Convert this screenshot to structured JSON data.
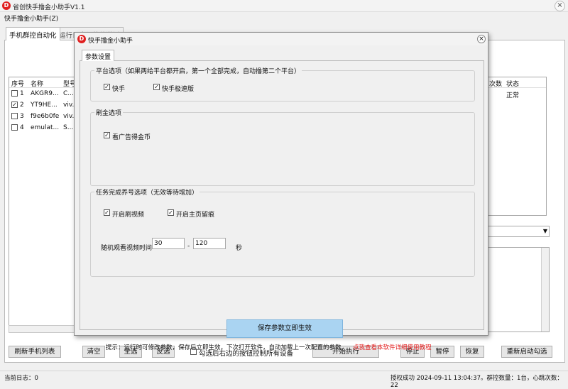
{
  "app": {
    "title": "省创快手撸金小助手V1.1",
    "menu_label": "快手撸金小助手(Z)",
    "close_glyph": "×",
    "icon_letter": "D"
  },
  "tabs": [
    {
      "label": "手机群控自动化"
    },
    {
      "label": "运行日志与软件激活"
    }
  ],
  "device_list": {
    "columns": [
      "序号",
      "名称",
      "型号"
    ],
    "rows": [
      {
        "index": "1",
        "name": "AKGR9...",
        "model": "C...",
        "checked": false
      },
      {
        "index": "2",
        "name": "YT9HE...",
        "model": "viv...",
        "checked": true
      },
      {
        "index": "3",
        "name": "f9e6b0fe",
        "model": "viv...",
        "checked": false
      },
      {
        "index": "4",
        "name": "emulat...",
        "model": "S...",
        "checked": false
      }
    ]
  },
  "right_list": {
    "columns": [
      "次数",
      "状态"
    ],
    "row_status": "正常"
  },
  "buttons": {
    "refresh": "刷新手机列表",
    "clear": "清空",
    "select_all": "全选",
    "invert": "反选",
    "start": "开始执行",
    "stop": "停止",
    "pause": "暂停",
    "resume": "恢复",
    "restart": "重新启动勾选"
  },
  "bottom_checkbox_label": "勾选后右边的按钮控制所有设备",
  "status_bar": {
    "log_count": "当前日志：0",
    "info": "授权成功 2024-09-11 13:04:37。群控数量：1台，心跳次数：22"
  },
  "dialog": {
    "title": "快手撸金小助手",
    "tab": "参数设置",
    "platform_group": {
      "title": "平台选项（如果两给平台都开启，第一个全部完成，自动撸第二个平台）",
      "options": [
        {
          "label": "快手",
          "checked": true
        },
        {
          "label": "快手极速版",
          "checked": true
        }
      ]
    },
    "gold_group": {
      "title": "刷金选项",
      "options": [
        {
          "label": "看广告得金币",
          "checked": true
        }
      ]
    },
    "task_group": {
      "title": "任务完成养号选项（无效等待增加）",
      "options": [
        {
          "label": "开启刷视频",
          "checked": true
        },
        {
          "label": "开启主页留痕",
          "checked": true
        }
      ],
      "random_label": "随机观看视频时间",
      "min_value": "30",
      "dash": "-",
      "max_value": "120",
      "unit": "秒"
    },
    "save_button": "保存参数立即生效",
    "hint": "提示：运行时可修改参数，保存后立即生效，下次打开软件，自动加载上一次配置的参数。",
    "help_link": "点我查看本软件详细使用教程"
  },
  "colors": {
    "accent_red": "#e02020",
    "save_button_bg": "#aad4f2",
    "link_red": "#e21a1a"
  }
}
